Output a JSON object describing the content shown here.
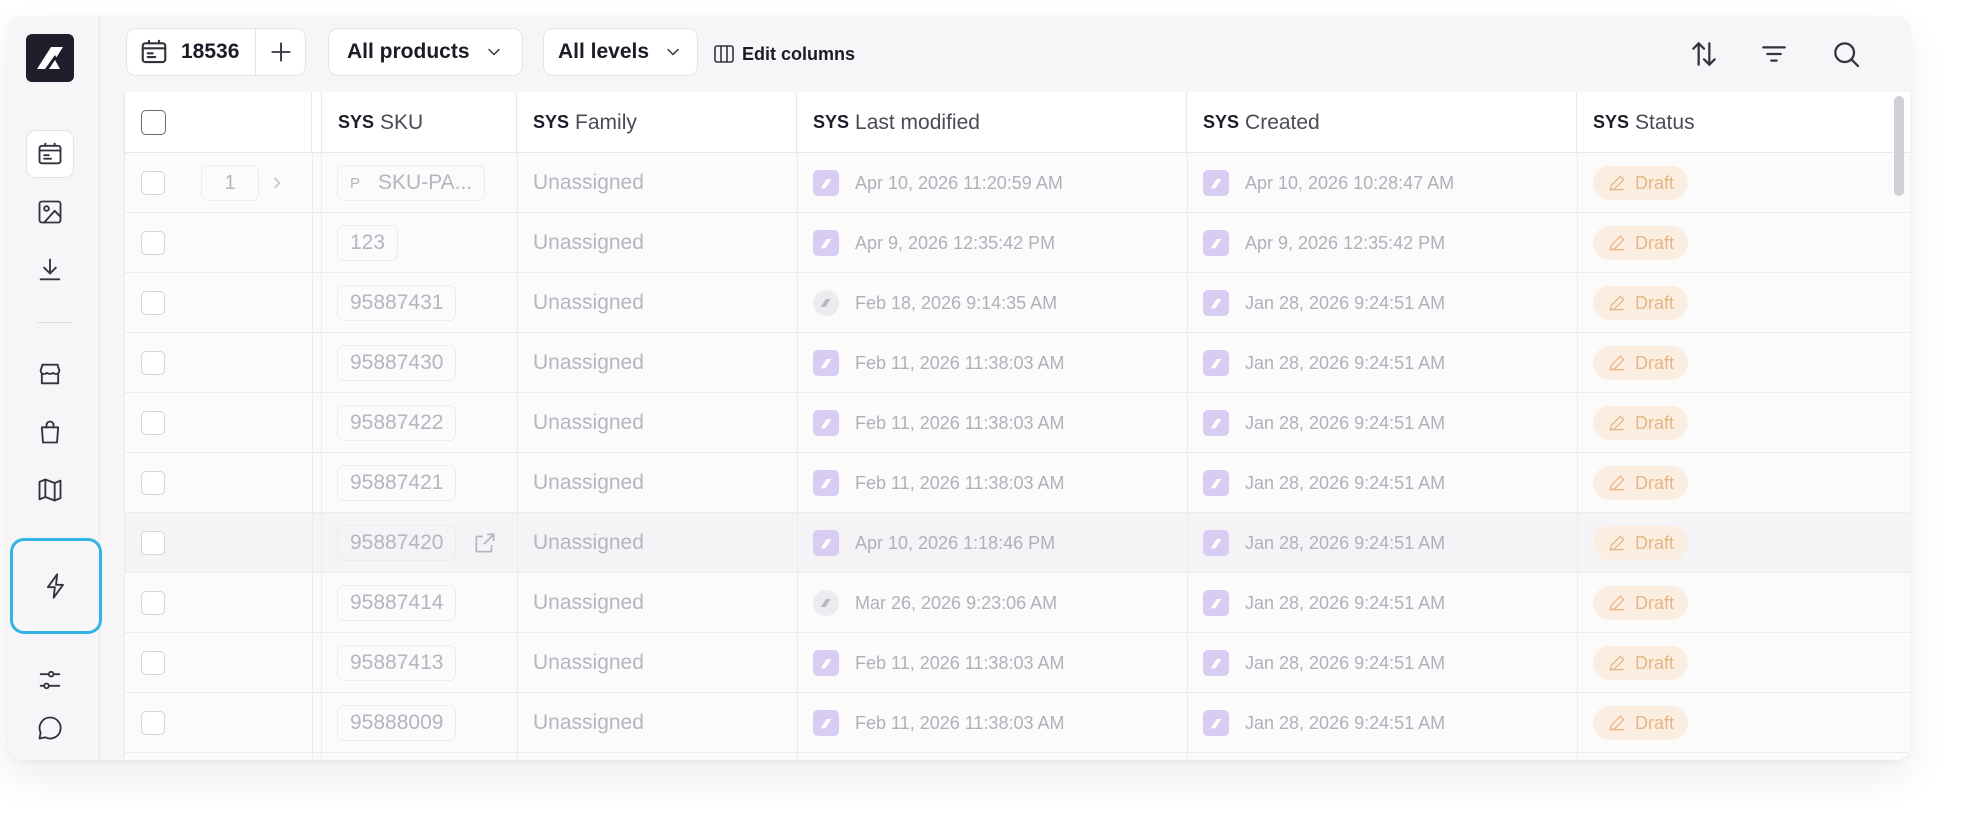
{
  "sidebar": {
    "items": [
      {
        "icon": "product-catalog-icon",
        "active": true
      },
      {
        "icon": "image-icon"
      },
      {
        "icon": "download-icon"
      },
      {
        "icon": "store-icon"
      },
      {
        "icon": "shopping-bag-icon"
      },
      {
        "icon": "book-icon"
      },
      {
        "icon": "lightning-icon",
        "focused": true
      },
      {
        "icon": "sliders-icon"
      },
      {
        "icon": "chat-bubble-icon"
      }
    ],
    "accent_focus_color": "#35b4e4"
  },
  "toolbar": {
    "count": "18536",
    "products_filter": "All products",
    "levels_filter": "All levels",
    "edit_columns_label": "Edit columns"
  },
  "table": {
    "columns": [
      {
        "prefix": "SYS",
        "label": "SKU"
      },
      {
        "prefix": "SYS",
        "label": "Family"
      },
      {
        "prefix": "SYS",
        "label": "Last modified"
      },
      {
        "prefix": "SYS",
        "label": "Created"
      },
      {
        "prefix": "SYS",
        "label": "Status"
      }
    ],
    "rows": [
      {
        "page": "1",
        "prefix": "P",
        "sku": "SKU-PA...",
        "family": "Unassigned",
        "modified": "Apr 10, 2026 11:20:59 AM",
        "created": "Apr 10, 2026 10:28:47 AM",
        "status": "Draft"
      },
      {
        "sku": "123",
        "family": "Unassigned",
        "modified": "Apr 9, 2026 12:35:42 PM",
        "created": "Apr 9, 2026 12:35:42 PM",
        "status": "Draft"
      },
      {
        "sku": "95887431",
        "family": "Unassigned",
        "modified": "Feb 18, 2026 9:14:35 AM",
        "created": "Jan 28, 2026 9:24:51 AM",
        "status": "Draft"
      },
      {
        "sku": "95887430",
        "family": "Unassigned",
        "modified": "Feb 11, 2026 11:38:03 AM",
        "created": "Jan 28, 2026 9:24:51 AM",
        "status": "Draft"
      },
      {
        "sku": "95887422",
        "family": "Unassigned",
        "modified": "Feb 11, 2026 11:38:03 AM",
        "created": "Jan 28, 2026 9:24:51 AM",
        "status": "Draft"
      },
      {
        "sku": "95887421",
        "family": "Unassigned",
        "modified": "Feb 11, 2026 11:38:03 AM",
        "created": "Jan 28, 2026 9:24:51 AM",
        "status": "Draft"
      },
      {
        "sku": "95887420",
        "family": "Unassigned",
        "modified": "Apr 10, 2026 1:18:46 PM",
        "created": "Jan 28, 2026 9:24:51 AM",
        "status": "Draft"
      },
      {
        "sku": "95887414",
        "family": "Unassigned",
        "modified": "Mar 26, 2026 9:23:06 AM",
        "created": "Jan 28, 2026 9:24:51 AM",
        "status": "Draft"
      },
      {
        "sku": "95887413",
        "family": "Unassigned",
        "modified": "Feb 11, 2026 11:38:03 AM",
        "created": "Jan 28, 2026 9:24:51 AM",
        "status": "Draft"
      },
      {
        "sku": "95888009",
        "family": "Unassigned",
        "modified": "Feb 11, 2026 11:38:03 AM",
        "created": "Jan 28, 2026 9:24:51 AM",
        "status": "Draft"
      }
    ]
  }
}
